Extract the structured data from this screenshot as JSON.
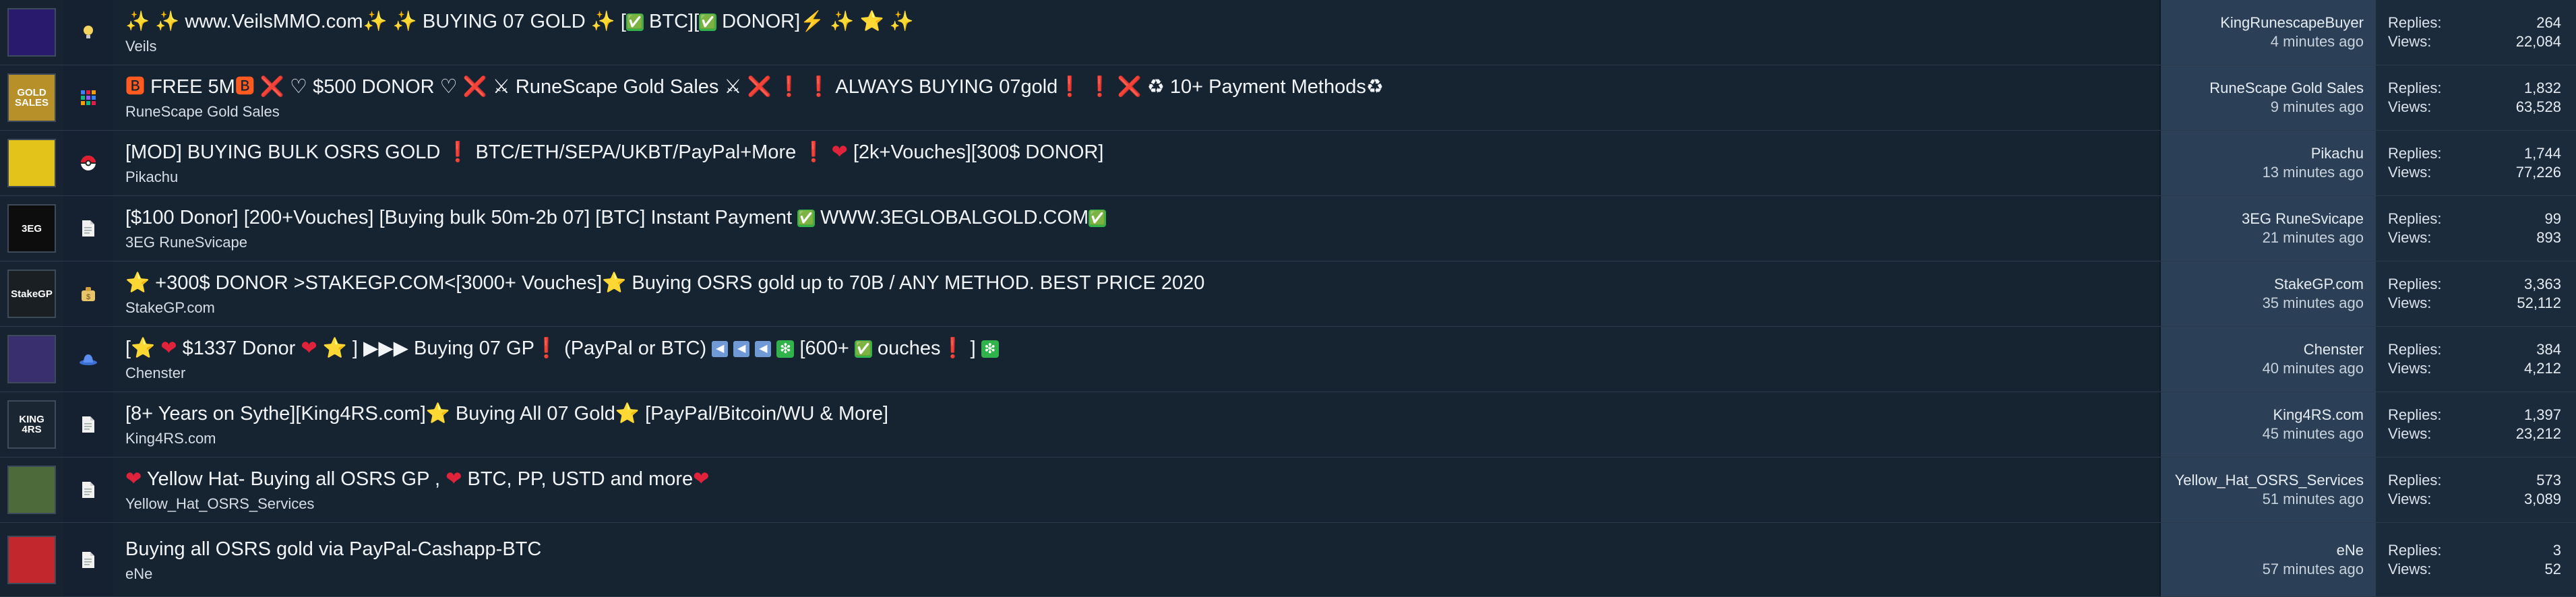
{
  "threads": [
    {
      "title_parts": [
        "✨ ✨ www.VeilsMMO.com✨ ✨  BUYING 07 GOLD ✨  [",
        "✅",
        " BTC][",
        "✅",
        " DONOR]",
        "⚡",
        "  ✨ ",
        "⭐",
        " ✨"
      ],
      "author": "Veils",
      "last_post_user": "KingRunescapeBuyer",
      "last_post_time": "4 minutes ago",
      "replies": "264",
      "views": "22,084",
      "prefix_icon": "lightbulb-icon",
      "avatar_color": "#2a1a6e",
      "avatar_text": ""
    },
    {
      "title_parts": [
        "🅱",
        " FREE 5M",
        "🅱",
        " ",
        "❌",
        " ♡ $500 DONOR ♡ ",
        "❌",
        " ⚔ RuneScape Gold Sales ⚔ ",
        "❌",
        " ",
        "❗",
        " ",
        "❗",
        " ALWAYS BUYING 07gold",
        "❗",
        " ",
        "❗",
        " ",
        "❌",
        " ♻ 10+ Payment Methods♻"
      ],
      "author": "RuneScape Gold Sales",
      "last_post_user": "RuneScape Gold Sales",
      "last_post_time": "9 minutes ago",
      "replies": "1,832",
      "views": "63,528",
      "prefix_icon": "grid-icon",
      "avatar_color": "#b8902a",
      "avatar_text": "GOLD SALES"
    },
    {
      "title_parts": [
        "[MOD] BUYING BULK OSRS GOLD ",
        "❗",
        "  BTC/ETH/SEPA/UKBT/PayPal+More ",
        "❗",
        "  ",
        "❤",
        "  [2k+Vouches][300$ DONOR]"
      ],
      "author": "Pikachu",
      "last_post_user": "Pikachu",
      "last_post_time": "13 minutes ago",
      "replies": "1,744",
      "views": "77,226",
      "prefix_icon": "pokeball-icon",
      "avatar_color": "#e3c21a",
      "avatar_text": ""
    },
    {
      "title_parts": [
        "[$100 Donor] [200+Vouches] [Buying bulk 50m-2b 07] [BTC] Instant Payment ",
        "✅",
        "  WWW.3EGLOBALGOLD.COM",
        "✅"
      ],
      "author": "3EG RuneSvicape",
      "last_post_user": "3EG RuneSvicape",
      "last_post_time": "21 minutes ago",
      "replies": "99",
      "views": "893",
      "prefix_icon": "document-icon",
      "avatar_color": "#0d0d0d",
      "avatar_text": "3EG"
    },
    {
      "title_parts": [
        "⭐",
        " +300$ DONOR >STAKEGP.COM<[3000+ Vouches]",
        "⭐",
        " Buying OSRS gold up to 70B / ANY METHOD. BEST PRICE 2020"
      ],
      "author": "StakeGP.com",
      "last_post_user": "StakeGP.com",
      "last_post_time": "35 minutes ago",
      "replies": "3,363",
      "views": "52,112",
      "prefix_icon": "money-bag-icon",
      "avatar_color": "#1a1f24",
      "avatar_text": "StakeGP"
    },
    {
      "title_parts": [
        "[",
        "⭐",
        " ",
        "❤",
        "  $1337 Donor ",
        "❤",
        " ",
        "⭐",
        " ] ▶▶▶ Buying 07 GP",
        "❗",
        "  (PayPal or BTC) ",
        "◀",
        " ",
        "◀",
        " ",
        "◀",
        "  ",
        "❇",
        "  [600+ ",
        "✅",
        " ouches",
        "❗",
        " ] ",
        "❇"
      ],
      "author": "Chenster",
      "last_post_user": "Chenster",
      "last_post_time": "40 minutes ago",
      "replies": "384",
      "views": "4,212",
      "prefix_icon": "hat-icon",
      "avatar_color": "#3a2f6e",
      "avatar_text": ""
    },
    {
      "title_parts": [
        "[8+ Years on Sythe][King4RS.com]",
        "⭐",
        " Buying All 07 Gold",
        "⭐",
        " [PayPal/Bitcoin/WU & More]"
      ],
      "author": "King4RS.com",
      "last_post_user": "King4RS.com",
      "last_post_time": "45 minutes ago",
      "replies": "1,397",
      "views": "23,212",
      "prefix_icon": "document-icon",
      "avatar_color": "#1b2633",
      "avatar_text": "KING 4RS"
    },
    {
      "title_parts": [
        "❤",
        " Yellow Hat- Buying all OSRS GP , ",
        "❤",
        " BTC, PP, USTD and more",
        "❤"
      ],
      "author": "Yellow_Hat_OSRS_Services",
      "last_post_user": "Yellow_Hat_OSRS_Services",
      "last_post_time": "51 minutes ago",
      "replies": "573",
      "views": "3,089",
      "prefix_icon": "document-icon",
      "avatar_color": "#4d6b3a",
      "avatar_text": ""
    },
    {
      "title_parts": [
        "Buying all OSRS gold via PayPal-Cashapp-BTC"
      ],
      "author": "eNe",
      "last_post_user": "eNe",
      "last_post_time": "57 minutes ago",
      "replies": "3",
      "views": "52",
      "prefix_icon": "document-icon",
      "avatar_color": "#c1272d",
      "avatar_text": ""
    }
  ],
  "labels": {
    "replies": "Replies:",
    "views": "Views:"
  }
}
